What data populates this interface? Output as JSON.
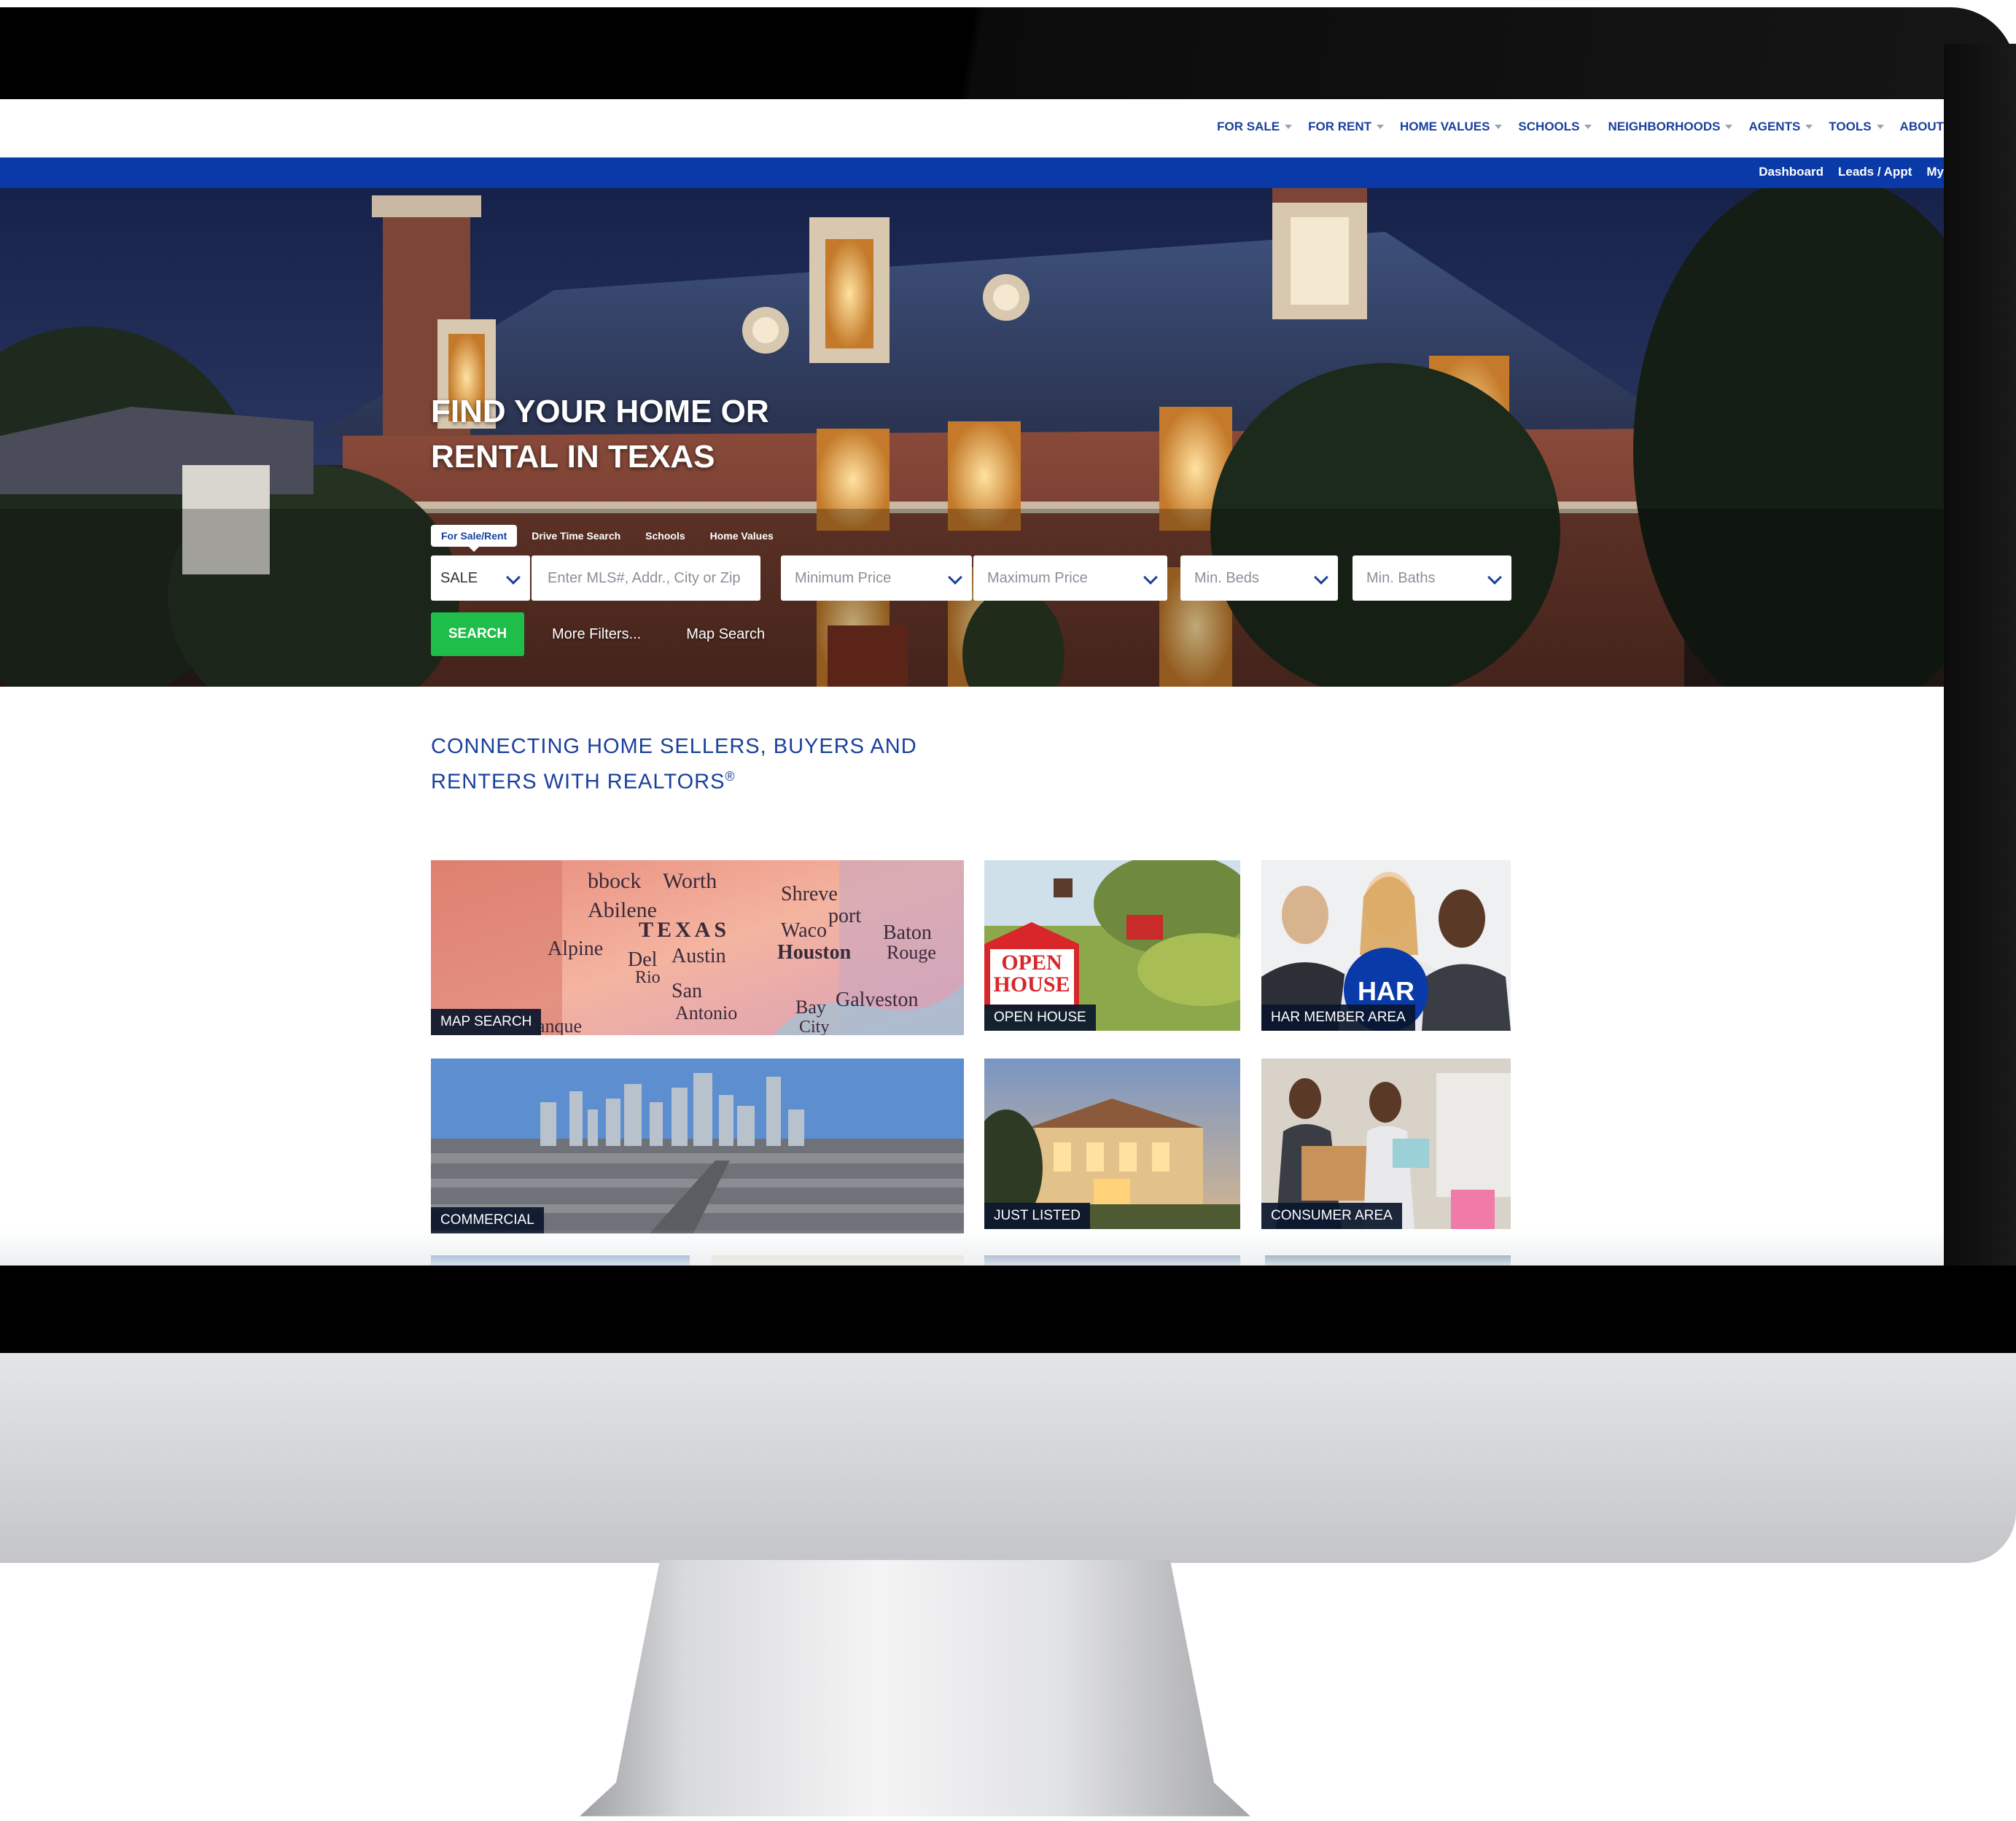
{
  "nav": {
    "items": [
      "FOR SALE",
      "FOR RENT",
      "HOME VALUES",
      "SCHOOLS",
      "NEIGHBORHOODS",
      "AGENTS",
      "TOOLS",
      "ABOUT"
    ]
  },
  "account_bar": {
    "links": [
      "Dashboard",
      "Leads / Appt",
      "My"
    ]
  },
  "hero": {
    "title_line1": "FIND YOUR HOME OR",
    "title_line2": "RENTAL IN TEXAS"
  },
  "search": {
    "tabs": [
      "For Sale/Rent",
      "Drive Time Search",
      "Schools",
      "Home Values"
    ],
    "active_tab": "For Sale/Rent",
    "type_value": "SALE",
    "location_placeholder": "Enter MLS#, Addr., City or Zip",
    "min_price_placeholder": "Minimum Price",
    "max_price_placeholder": "Maximum Price",
    "min_beds_placeholder": "Min. Beds",
    "min_baths_placeholder": "Min. Baths",
    "search_label": "SEARCH",
    "more_filters_label": "More Filters...",
    "map_search_label": "Map Search"
  },
  "tagline": {
    "line1": "CONNECTING HOME SELLERS, BUYERS AND",
    "line2": "RENTERS WITH REALTORS",
    "mark": "®"
  },
  "tiles": {
    "map_search": "MAP SEARCH",
    "open_house": "OPEN HOUSE",
    "har_member_area": "HAR MEMBER AREA",
    "commercial": "COMMERCIAL",
    "just_listed": "JUST LISTED",
    "consumer_area": "CONSUMER AREA"
  },
  "tile_art": {
    "map_words": [
      "bbock",
      "Worth",
      "Shreve",
      "Abilene",
      "port",
      "TEXAS",
      "Waco",
      "Baton",
      "Alpine",
      "Del",
      "Austin",
      "Houston",
      "Rouge",
      "Rio",
      "San",
      "Antonio",
      "Bay",
      "Galveston",
      "City",
      "anque"
    ],
    "open_house_sign": [
      "OPEN",
      "HOUSE"
    ],
    "har_badge": "HAR"
  },
  "colors": {
    "brand_blue": "#0a3aa8",
    "nav_text": "#1a3f9c",
    "search_green": "#1fbd4a"
  }
}
